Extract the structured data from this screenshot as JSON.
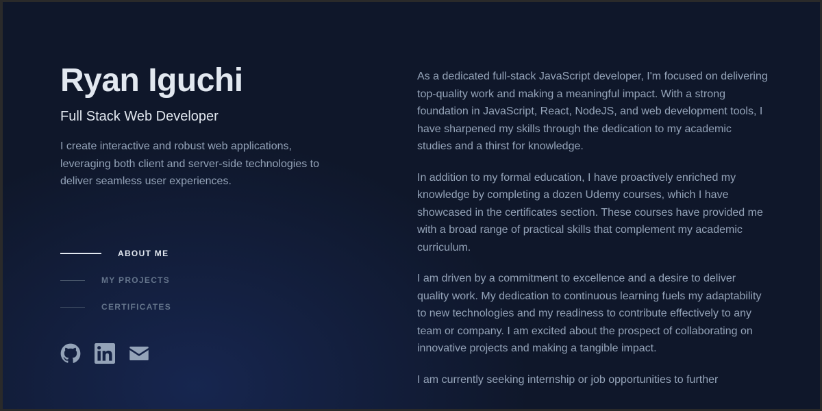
{
  "profile": {
    "name": "Ryan Iguchi",
    "role": "Full Stack Web Developer",
    "tagline": "I create interactive and robust web applications, leveraging both client and server-side technologies to deliver seamless user experiences."
  },
  "nav": {
    "items": [
      {
        "label": "ABOUT ME",
        "active": true
      },
      {
        "label": "MY PROJECTS",
        "active": false
      },
      {
        "label": "CERTIFICATES",
        "active": false
      }
    ]
  },
  "socials": {
    "icons": [
      "github-icon",
      "linkedin-icon",
      "email-icon"
    ]
  },
  "about": {
    "paragraphs": [
      "As a dedicated full-stack JavaScript developer, I'm focused on delivering top-quality work and making a meaningful impact. With a strong foundation in JavaScript, React, NodeJS, and web development tools, I have sharpened my skills through the dedication to my academic studies and a thirst for knowledge.",
      "In addition to my formal education, I have proactively enriched my knowledge by completing a dozen Udemy courses, which I have showcased in the certificates section. These courses have provided me with a broad range of practical skills that complement my academic curriculum.",
      "I am driven by a commitment to excellence and a desire to deliver quality work. My dedication to continuous learning fuels my adaptability to new technologies and my readiness to contribute effectively to any team or company. I am excited about the prospect of collaborating on innovative projects and making a tangible impact.",
      "I am currently seeking internship or job opportunities to further"
    ]
  },
  "colors": {
    "background": "#0f172a",
    "heading": "#e2e8f0",
    "body_text": "#94a3b8",
    "muted": "#64748b"
  }
}
